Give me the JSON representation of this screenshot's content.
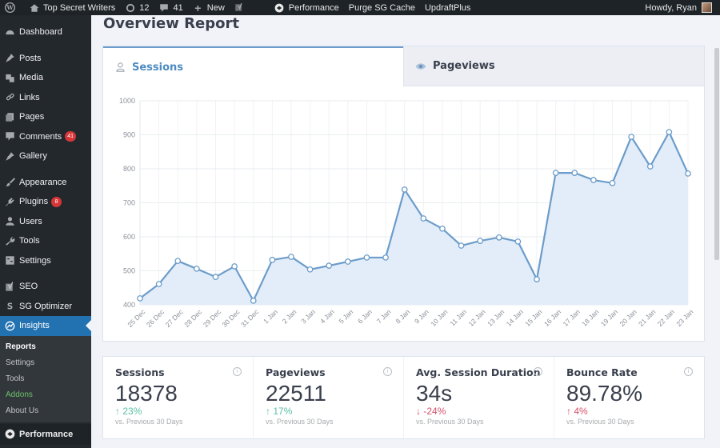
{
  "adminbar": {
    "wp_logo": "wordpress-icon",
    "site_name": "Top Secret Writers",
    "updates_count": "12",
    "comments_count": "41",
    "new_label": "New",
    "performance_label": "Performance",
    "purge_label": "Purge SG Cache",
    "updraft_label": "UpdraftPlus",
    "howdy": "Howdy, Ryan"
  },
  "sidebar": {
    "items": [
      {
        "label": "Dashboard",
        "icon": "dashboard-icon"
      },
      {
        "label": "Posts",
        "icon": "pin-icon"
      },
      {
        "label": "Media",
        "icon": "media-icon"
      },
      {
        "label": "Links",
        "icon": "link-icon"
      },
      {
        "label": "Pages",
        "icon": "pages-icon"
      },
      {
        "label": "Comments",
        "icon": "comment-icon",
        "badge": "41"
      },
      {
        "label": "Gallery",
        "icon": "pin-icon"
      },
      {
        "label": "Appearance",
        "icon": "brush-icon"
      },
      {
        "label": "Plugins",
        "icon": "plugin-icon",
        "badge": "8"
      },
      {
        "label": "Users",
        "icon": "user-icon"
      },
      {
        "label": "Tools",
        "icon": "wrench-icon"
      },
      {
        "label": "Settings",
        "icon": "settings-icon"
      },
      {
        "label": "SEO",
        "icon": "yoast-icon"
      },
      {
        "label": "SG Optimizer",
        "icon": "sg-icon"
      },
      {
        "label": "Insights",
        "icon": "insights-icon"
      }
    ],
    "submenu": [
      "Reports",
      "Settings",
      "Tools",
      "Addons",
      "About Us"
    ],
    "performance": "Performance"
  },
  "page": {
    "title": "Overview Report",
    "tabs": [
      {
        "label": "Sessions",
        "icon": "user-icon",
        "active": true
      },
      {
        "label": "Pageviews",
        "icon": "eye-icon",
        "active": false
      }
    ]
  },
  "chart_data": {
    "type": "area",
    "title": "",
    "xlabel": "",
    "ylabel": "",
    "ylim": [
      400,
      1000
    ],
    "yticks": [
      "400",
      "500",
      "600",
      "700",
      "800",
      "900",
      "1000"
    ],
    "grid": true,
    "categories": [
      "25 Dec",
      "26 Dec",
      "27 Dec",
      "28 Dec",
      "29 Dec",
      "30 Dec",
      "31 Dec",
      "1 Jan",
      "2 Jan",
      "3 Jan",
      "4 Jan",
      "5 Jan",
      "6 Jan",
      "7 Jan",
      "8 Jan",
      "9 Jan",
      "10 Jan",
      "11 Jan",
      "12 Jan",
      "13 Jan",
      "14 Jan",
      "15 Jan",
      "16 Jan",
      "17 Jan",
      "18 Jan",
      "19 Jan",
      "20 Jan",
      "21 Jan",
      "22 Jan",
      "23 Jan"
    ],
    "series": [
      {
        "name": "Sessions",
        "color": "#6c9cc9",
        "fill": "#e2edf9",
        "values": [
          419,
          461,
          529,
          506,
          482,
          513,
          412,
          532,
          541,
          504,
          515,
          527,
          539,
          539,
          739,
          654,
          624,
          574,
          588,
          598,
          586,
          475,
          788,
          788,
          767,
          758,
          894,
          807,
          908,
          786
        ]
      }
    ]
  },
  "stats": [
    {
      "title": "Sessions",
      "value": "18378",
      "change": "23%",
      "direction": "up",
      "tone": "good",
      "compare": "vs. Previous 30 Days"
    },
    {
      "title": "Pageviews",
      "value": "22511",
      "change": "17%",
      "direction": "up",
      "tone": "good",
      "compare": "vs. Previous 30 Days"
    },
    {
      "title": "Avg. Session Duration",
      "value": "34s",
      "change": "-24%",
      "direction": "down",
      "tone": "bad",
      "compare": "vs. Previous 30 Days"
    },
    {
      "title": "Bounce Rate",
      "value": "89.78%",
      "change": "4%",
      "direction": "up",
      "tone": "bad",
      "compare": "vs. Previous 30 Days"
    }
  ],
  "colors": {
    "accent": "#2271b1",
    "line": "#6c9cc9",
    "good": "#5cc0a7",
    "bad": "#d4516b"
  }
}
